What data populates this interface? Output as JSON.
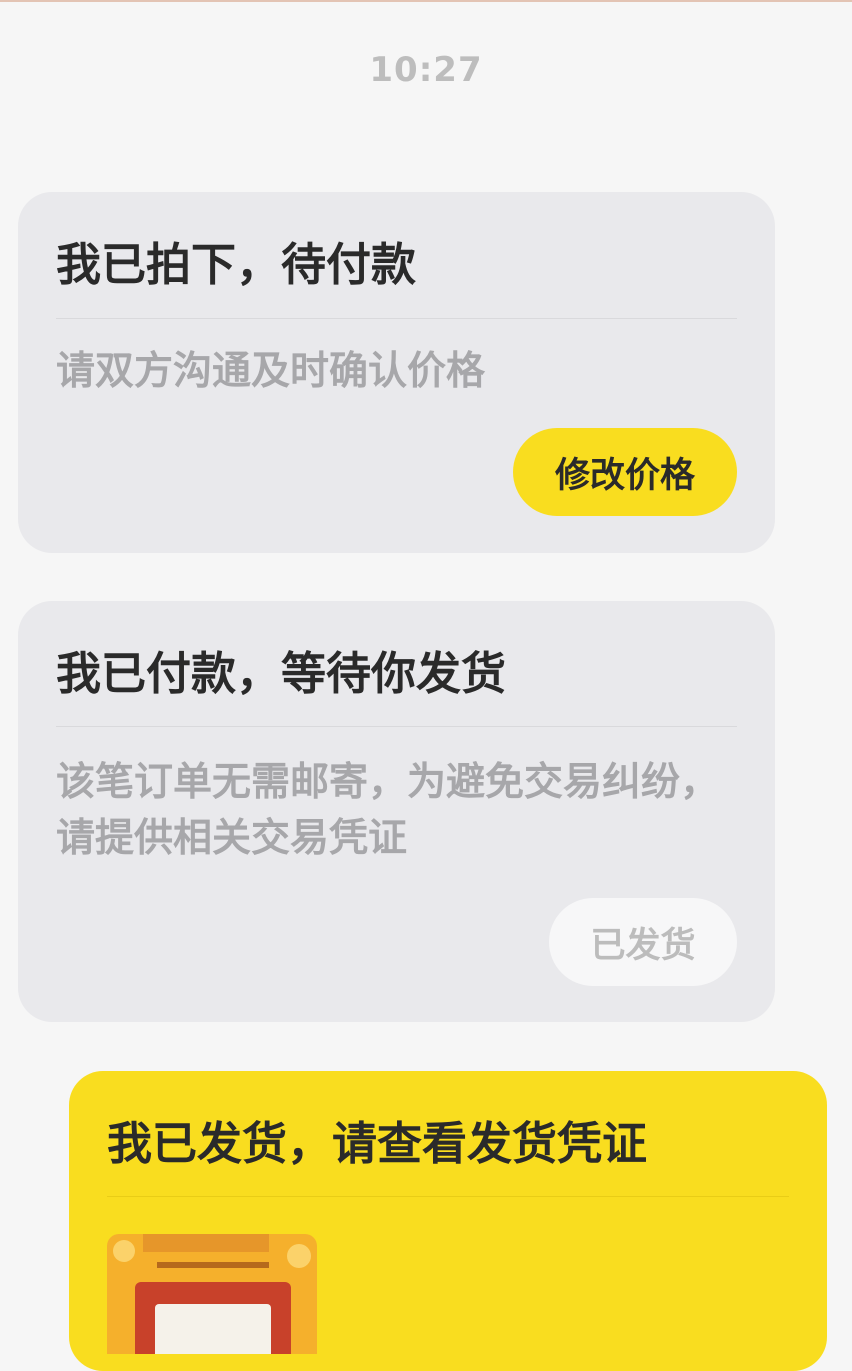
{
  "timestamp": "10:27",
  "messages": [
    {
      "title": "我已拍下，待付款",
      "description": "请双方沟通及时确认价格",
      "button_label": "修改价格"
    },
    {
      "title": "我已付款，等待你发货",
      "description": "该笔订单无需邮寄，为避免交易纠纷，请提供相关交易凭证",
      "button_label": "已发货"
    },
    {
      "title": "我已发货，请查看发货凭证",
      "image": "shipping-proof-thumbnail"
    }
  ],
  "colors": {
    "accent_yellow": "#f9dd1f",
    "card_gray": "#e9e9ec",
    "background": "#f6f6f6"
  }
}
